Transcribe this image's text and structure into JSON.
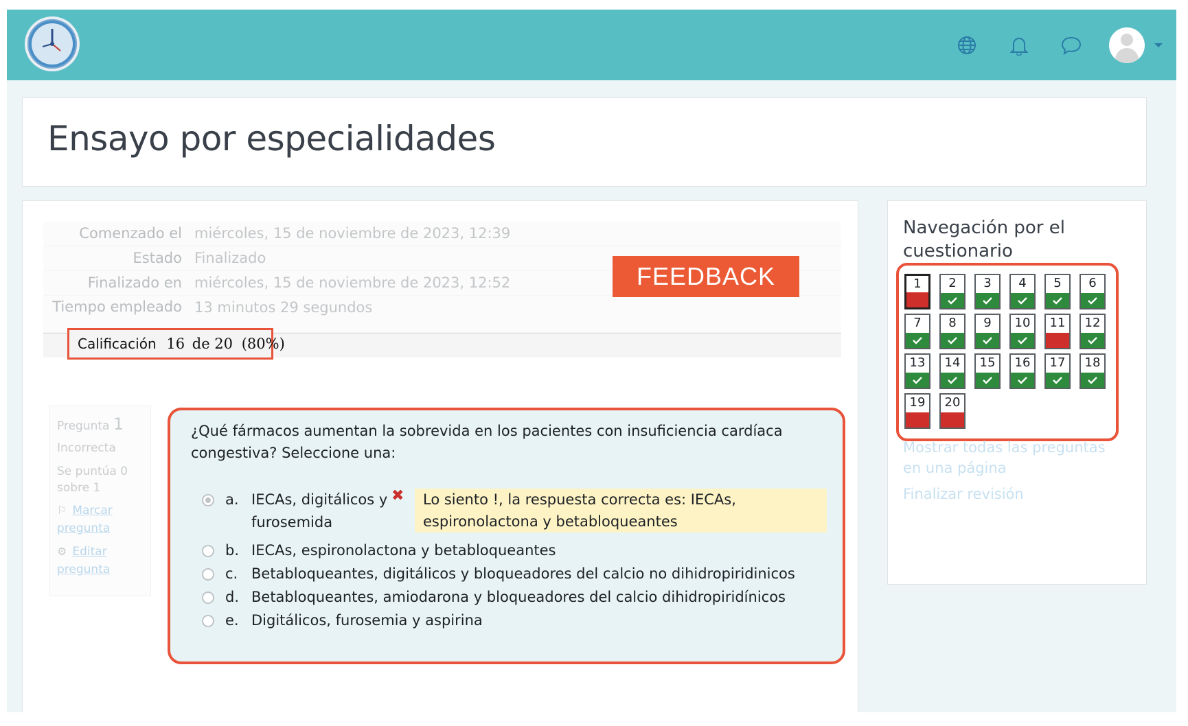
{
  "header": {
    "title": "Ensayo por especialidades"
  },
  "summary": {
    "rows": [
      {
        "label": "Comenzado el",
        "value": "miércoles, 15 de noviembre de 2023, 12:39"
      },
      {
        "label": "Estado",
        "value": "Finalizado"
      },
      {
        "label": "Finalizado en",
        "value": "miércoles, 15 de noviembre de 2023, 12:52"
      },
      {
        "label": "Tiempo empleado",
        "value": "13 minutos 29 segundos"
      }
    ],
    "grade_label": "Calificación",
    "grade_score": "16",
    "grade_rest": "de 20",
    "grade_percent": "(80%)"
  },
  "feedback_badge": "FEEDBACK",
  "question_info": {
    "label": "Pregunta",
    "number": "1",
    "status": "Incorrecta",
    "score_line1": "Se puntúa 0",
    "score_line2": "sobre 1",
    "flag_line1": "Marcar",
    "flag_line2": "pregunta",
    "edit_line1": "Editar",
    "edit_line2": "pregunta"
  },
  "question": {
    "text": "¿Qué fármacos aumentan la sobrevida en los pacientes con insuficiencia cardíaca congestiva? Seleccione una:",
    "options": [
      {
        "letter": "a.",
        "line1": "IECAs, digitálicos y",
        "line2": "furosemida",
        "checked": true
      },
      {
        "letter": "b.",
        "line1": "IECAs, espironolactona y betabloqueantes"
      },
      {
        "letter": "c.",
        "line1": "Betabloqueantes, digitálicos y bloqueadores del calcio no dihidropiridinicos"
      },
      {
        "letter": "d.",
        "line1": "Betabloqueantes, amiodarona y bloqueadores del calcio dihidropiridínicos"
      },
      {
        "letter": "e.",
        "line1": "Digitálicos, furosemia y aspirina"
      }
    ],
    "feedback_line1": "Lo siento !, la respuesta correcta es: IECAs,",
    "feedback_line2": "espironolactona y betabloqueantes",
    "wrong_mark": "✖"
  },
  "navigation": {
    "title": "Navegación por el cuestionario",
    "questions": [
      {
        "n": "1",
        "state": "incorrect",
        "current": true
      },
      {
        "n": "2",
        "state": "correct"
      },
      {
        "n": "3",
        "state": "correct"
      },
      {
        "n": "4",
        "state": "correct"
      },
      {
        "n": "5",
        "state": "correct"
      },
      {
        "n": "6",
        "state": "correct"
      },
      {
        "n": "7",
        "state": "correct"
      },
      {
        "n": "8",
        "state": "correct"
      },
      {
        "n": "9",
        "state": "correct"
      },
      {
        "n": "10",
        "state": "correct"
      },
      {
        "n": "11",
        "state": "incorrect"
      },
      {
        "n": "12",
        "state": "correct"
      },
      {
        "n": "13",
        "state": "correct"
      },
      {
        "n": "14",
        "state": "correct"
      },
      {
        "n": "15",
        "state": "correct"
      },
      {
        "n": "16",
        "state": "correct"
      },
      {
        "n": "17",
        "state": "correct"
      },
      {
        "n": "18",
        "state": "correct"
      },
      {
        "n": "19",
        "state": "incorrect"
      },
      {
        "n": "20",
        "state": "incorrect"
      }
    ],
    "show_all_line1": "Mostrar todas las preguntas",
    "show_all_line2": "en una página",
    "finish": "Finalizar revisión"
  },
  "icons": {
    "navbar": [
      "globe-icon",
      "bell-icon",
      "chat-icon",
      "user-avatar"
    ],
    "check": "check-icon"
  },
  "colors": {
    "navbar": "#57bec4",
    "highlight": "#e8533a",
    "correct": "#2e8b3e",
    "incorrect": "#cf2f2a",
    "feedback_bg": "#fdf3c5"
  }
}
